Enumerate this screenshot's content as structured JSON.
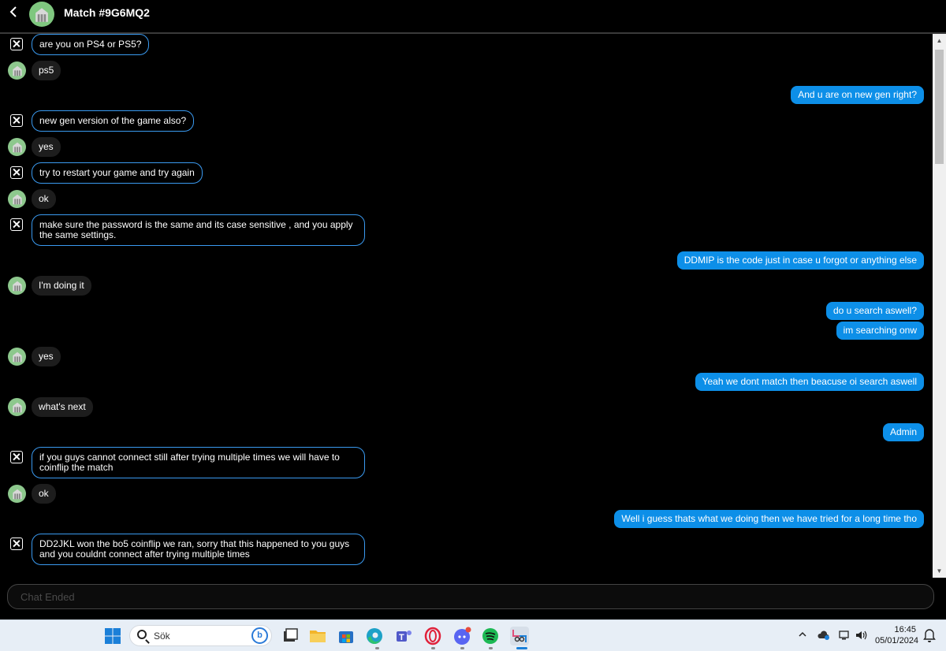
{
  "header": {
    "title": "Match #9G6MQ2"
  },
  "messages": [
    {
      "side": "admin",
      "text": "are you on PS4 or PS5?"
    },
    {
      "side": "user",
      "text": "ps5"
    },
    {
      "side": "me",
      "text": "And u are on new gen right?"
    },
    {
      "side": "admin",
      "text": "new gen version of the game also?"
    },
    {
      "side": "user",
      "text": "yes"
    },
    {
      "side": "admin",
      "text": "try to restart your game and try again"
    },
    {
      "side": "user",
      "text": "ok"
    },
    {
      "side": "admin",
      "text": "make sure the password is the same and its case sensitive , and you apply the same settings."
    },
    {
      "side": "me",
      "text": "DDMIP is the code just in case u forgot or anything else"
    },
    {
      "side": "user",
      "text": "I'm doing it"
    },
    {
      "side": "me",
      "text": "do u search aswell?"
    },
    {
      "side": "me",
      "text": "im searching onw"
    },
    {
      "side": "user",
      "text": "yes"
    },
    {
      "side": "me",
      "text": "Yeah we dont match then beacuse oi search aswell"
    },
    {
      "side": "user",
      "text": "what's next"
    },
    {
      "side": "me",
      "text": "Admin"
    },
    {
      "side": "admin",
      "text": "if you guys cannot connect still after trying multiple times we will have to coinflip the match"
    },
    {
      "side": "user",
      "text": "ok"
    },
    {
      "side": "me",
      "text": "Well i guess thats what we doing then we have tried for a long time tho"
    },
    {
      "side": "admin",
      "text": "DD2JKL won the bo5 coinflip we ran, sorry that this happened to you guys and you couldnt connect after trying multiple times"
    }
  ],
  "input": {
    "placeholder": "Chat Ended"
  },
  "taskbar": {
    "search_label": "Sök",
    "time": "16:45",
    "date": "05/01/2024",
    "apps": [
      "start-icon",
      "file-explorer-icon",
      "microsoft-store-icon",
      "edge-icon",
      "teams-icon",
      "opera-gx-icon",
      "discord-icon",
      "spotify-icon",
      "snipping-tool-icon"
    ]
  },
  "colors": {
    "my_bubble": "#0d8fe8",
    "admin_border": "#3a9af0",
    "user_bubble": "#1d1d1d",
    "avatar": "#8dc88d"
  }
}
